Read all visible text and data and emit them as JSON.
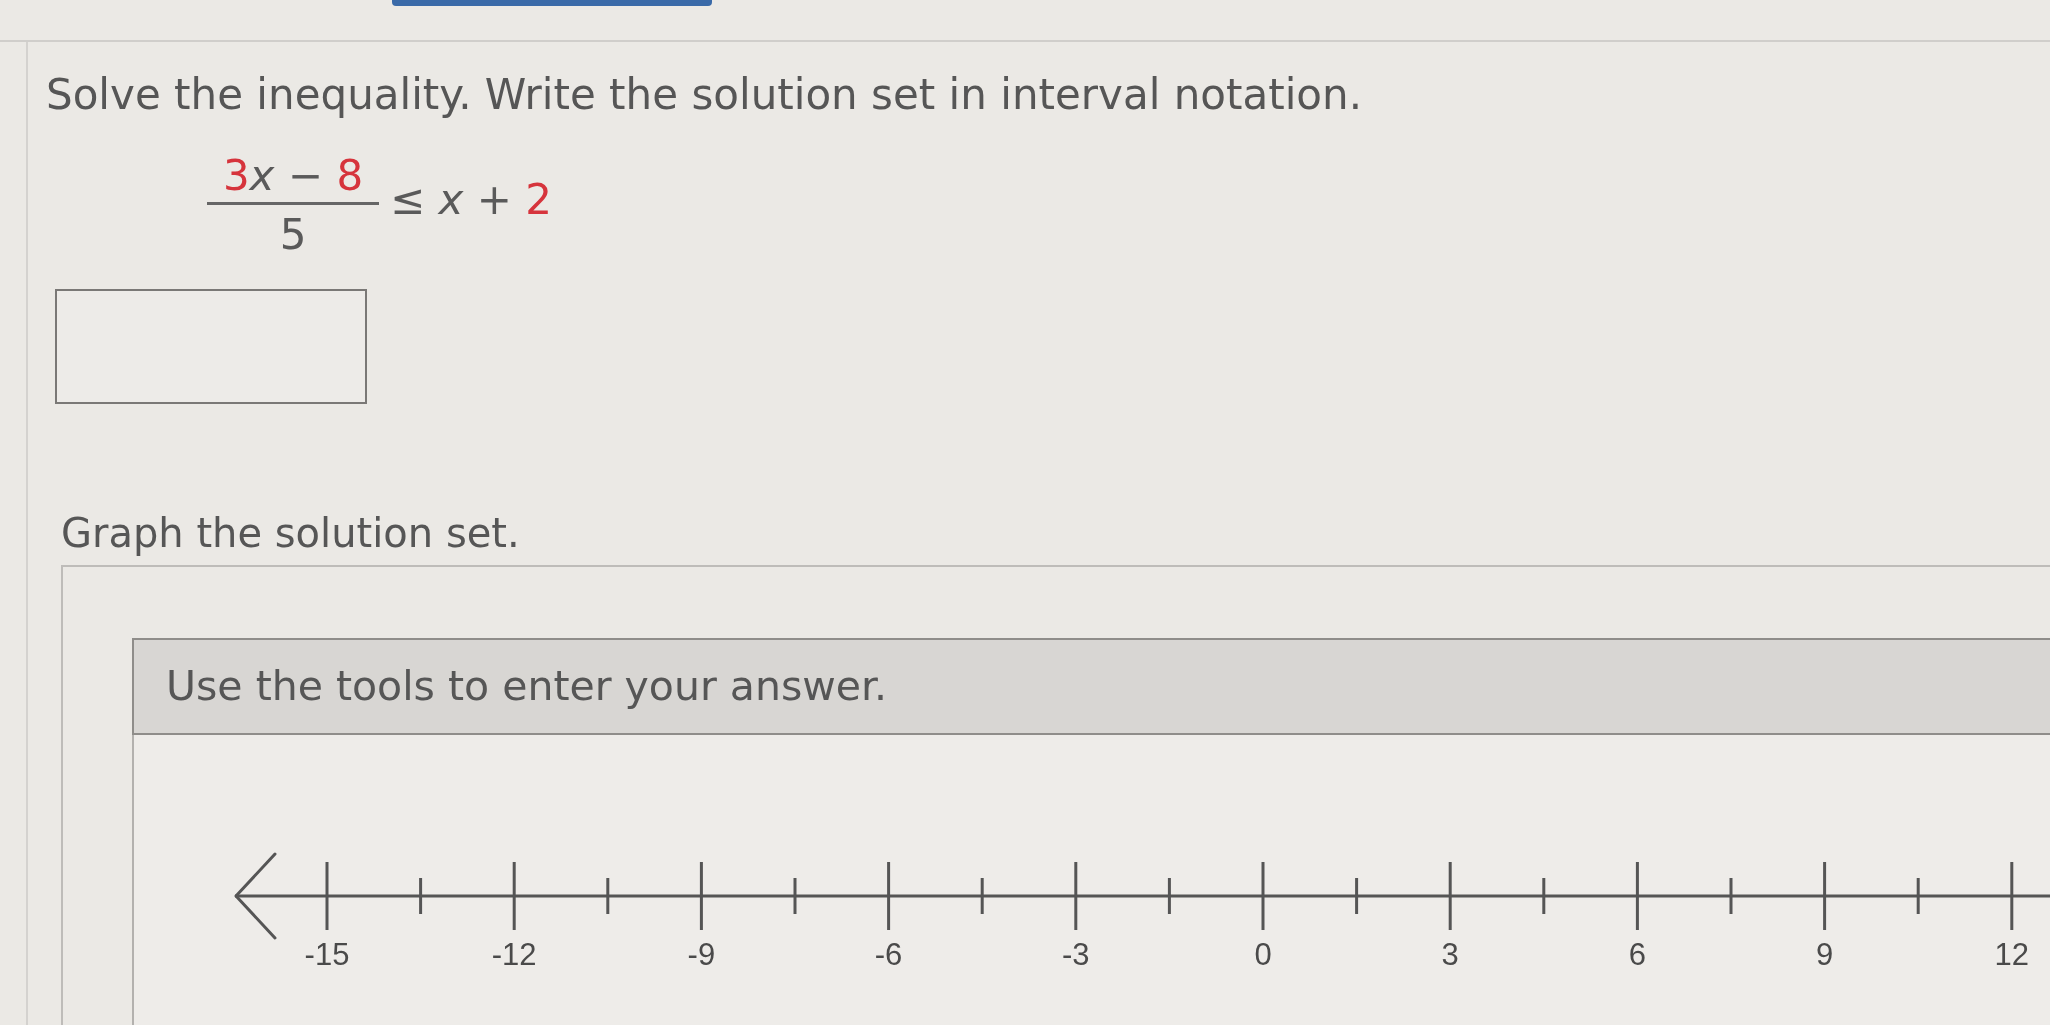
{
  "question": {
    "prompt": "Solve the inequality. Write the solution set in interval notation.",
    "inequality": {
      "numerator": [
        {
          "text": "3",
          "kind": "number",
          "highlighted": true
        },
        {
          "text": "x",
          "kind": "variable",
          "highlighted": false
        },
        {
          "text": "−",
          "kind": "operator",
          "highlighted": false
        },
        {
          "text": "8",
          "kind": "number",
          "highlighted": true
        }
      ],
      "denominator": [
        {
          "text": "5",
          "kind": "number",
          "highlighted": false
        }
      ],
      "right_side": [
        {
          "text": "≤",
          "kind": "operator",
          "highlighted": false
        },
        {
          "text": "x",
          "kind": "variable",
          "highlighted": false
        },
        {
          "text": "+",
          "kind": "operator",
          "highlighted": false
        },
        {
          "text": "2",
          "kind": "number",
          "highlighted": true
        }
      ]
    }
  },
  "graph": {
    "prompt": "Graph the solution set.",
    "instructions": "Use the tools to enter your answer.",
    "number_line": {
      "tick_labels": [
        "-15",
        "-12",
        "-9",
        "-6",
        "-3",
        "0",
        "3",
        "6",
        "9",
        "12"
      ]
    }
  }
}
